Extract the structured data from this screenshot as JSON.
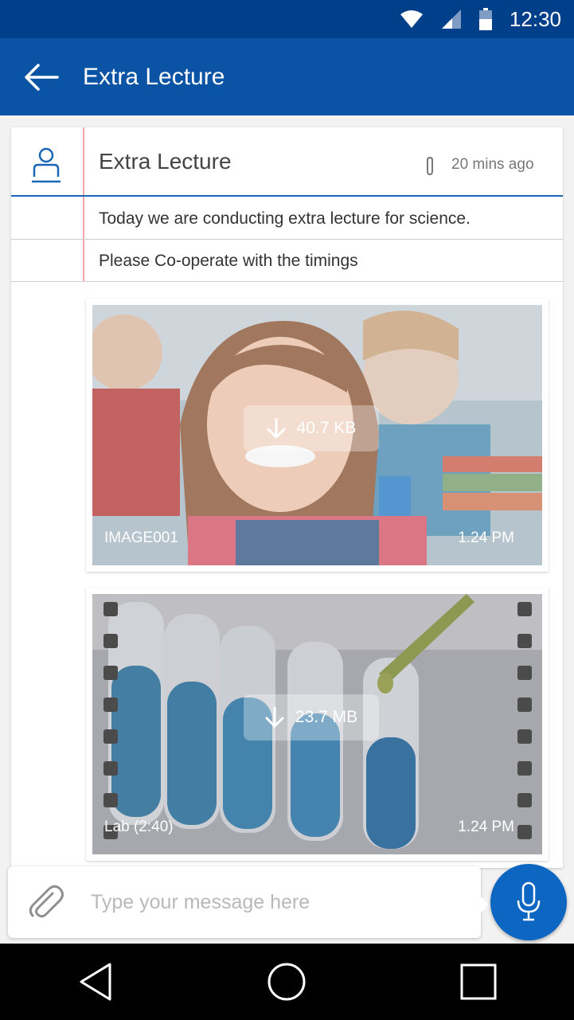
{
  "status_bar": {
    "time": "12:30",
    "icons": [
      "wifi-icon",
      "signal-icon",
      "battery-icon"
    ]
  },
  "app_bar": {
    "title": "Extra Lecture",
    "back_icon": "back-arrow-icon"
  },
  "message": {
    "title": "Extra Lecture",
    "time_ago": "20 mins ago",
    "lines": [
      "Today we are conducting extra lecture for science.",
      "Please Co-operate with the timings"
    ]
  },
  "attachments": [
    {
      "size": "40.7 KB",
      "name": "IMAGE001",
      "time": "1.24 PM",
      "kind": "image"
    },
    {
      "size": "23.7 MB",
      "name": "Lab (2:40)",
      "time": "1.24 PM",
      "kind": "video"
    }
  ],
  "composer": {
    "placeholder": "Type your message here"
  },
  "colors": {
    "primary": "#0b53a5",
    "status": "#003f8a",
    "accent": "#0d66c2"
  }
}
